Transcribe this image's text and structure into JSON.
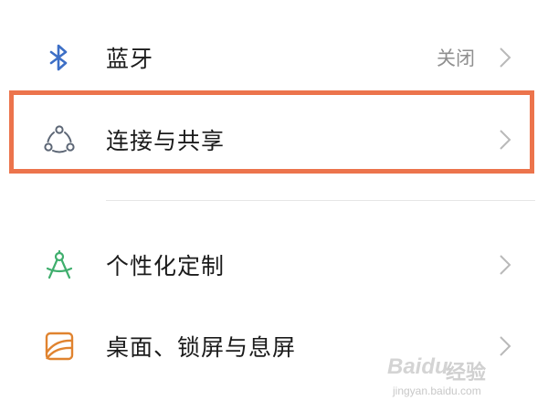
{
  "settings": {
    "items": [
      {
        "id": "bluetooth",
        "icon": "bluetooth-icon",
        "label": "蓝牙",
        "value": "关闭"
      },
      {
        "id": "connection-sharing",
        "icon": "connection-share-icon",
        "label": "连接与共享",
        "value": ""
      },
      {
        "id": "personalization",
        "icon": "compass-drafting-icon",
        "label": "个性化定制",
        "value": ""
      },
      {
        "id": "desktop-lock",
        "icon": "wallpaper-icon",
        "label": "桌面、锁屏与息屏",
        "value": ""
      }
    ]
  },
  "watermark": {
    "brand": "Baidu",
    "text": "经验",
    "url": "jingyan.baidu.com"
  },
  "colors": {
    "highlight": "#ec744c",
    "bluetooth_icon": "#3d6fc6",
    "connection_icon": "#5c6675",
    "personalization_icon": "#3fae6d",
    "desktop_icon": "#e0832f"
  }
}
